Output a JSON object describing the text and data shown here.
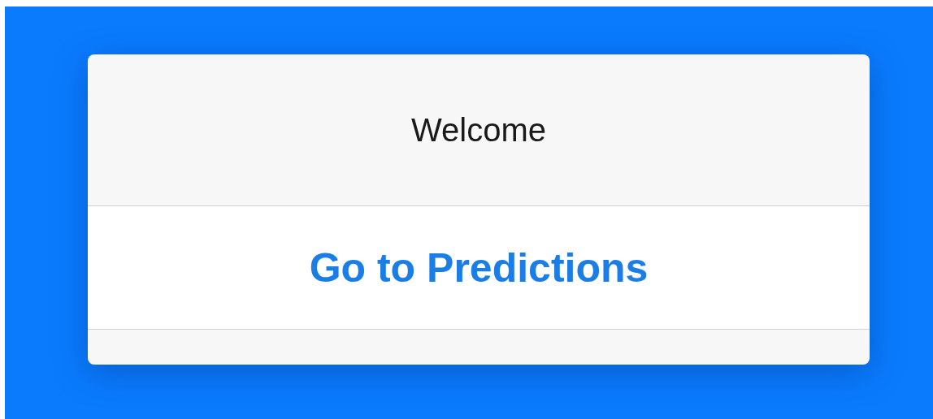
{
  "dialog": {
    "title": "Welcome",
    "action": "Go to Predictions"
  }
}
